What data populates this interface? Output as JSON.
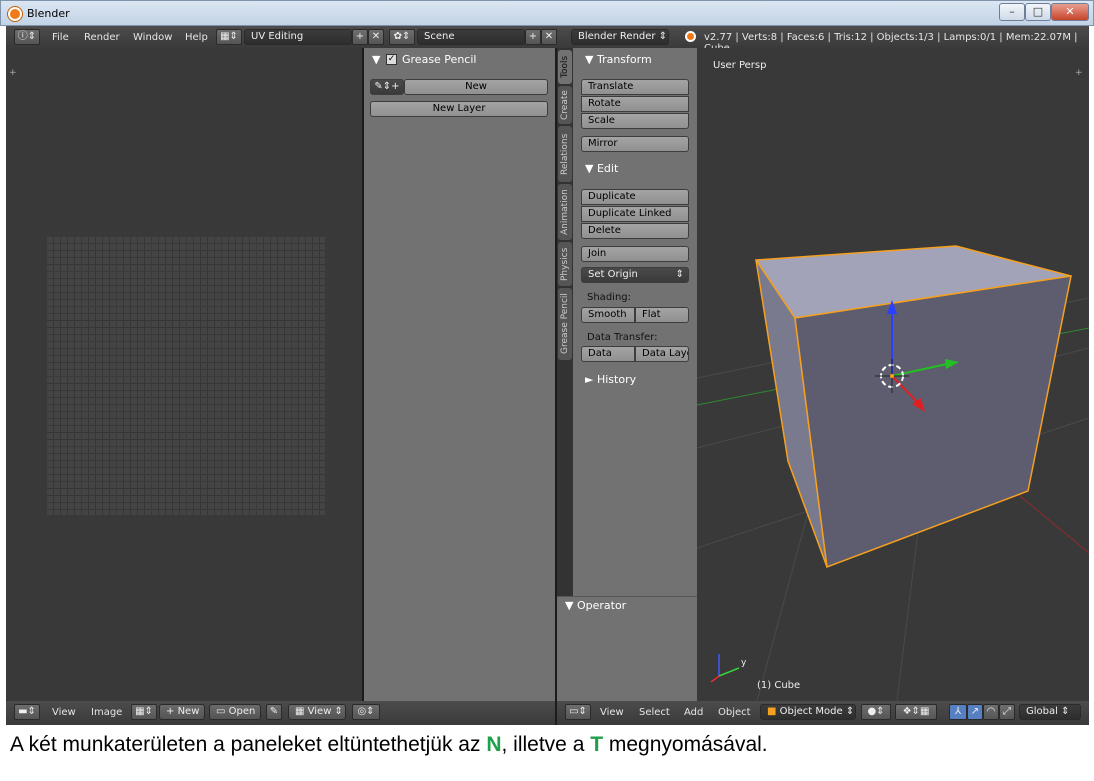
{
  "window": {
    "title": "Blender",
    "min": "–",
    "max": "□",
    "close": "✕"
  },
  "topbar": {
    "menus": [
      "File",
      "Render",
      "Window",
      "Help"
    ],
    "layout": "UV Editing",
    "scene": "Scene",
    "engine": "Blender Render",
    "stats": "v2.77 | Verts:8 | Faces:6 | Tris:12 | Objects:1/3 | Lamps:0/1 | Mem:22.07M | Cube"
  },
  "grease_pencil": {
    "title": "Grease Pencil",
    "new_label": "New",
    "new_layer_label": "New Layer"
  },
  "tabs": [
    "Tools",
    "Create",
    "Relations",
    "Animation",
    "Physics",
    "Grease Pencil"
  ],
  "tools": {
    "transform_title": "Transform",
    "translate": "Translate",
    "rotate": "Rotate",
    "scale": "Scale",
    "mirror": "Mirror",
    "edit_title": "Edit",
    "duplicate": "Duplicate",
    "duplicate_linked": "Duplicate Linked",
    "delete": "Delete",
    "join": "Join",
    "set_origin": "Set Origin",
    "shading_label": "Shading:",
    "smooth": "Smooth",
    "flat": "Flat",
    "data_transfer_label": "Data Transfer:",
    "data": "Data",
    "data_layo": "Data Layo",
    "history_title": "History",
    "operator_title": "Operator"
  },
  "viewport": {
    "persp": "User Persp",
    "object": "(1) Cube",
    "axis_y": "y"
  },
  "uv_footer": {
    "view": "View",
    "image": "Image",
    "new": "New",
    "open": "Open",
    "view2": "View"
  },
  "view3d_footer": {
    "view": "View",
    "select": "Select",
    "add": "Add",
    "object": "Object",
    "mode": "Object Mode",
    "orientation": "Global"
  },
  "caption": {
    "pre": "A két munkaterületen a paneleket eltüntethetjük az ",
    "key1": "N",
    "mid": ", illetve a ",
    "key2": "T",
    "post": " megnyomásával."
  },
  "colors": {
    "accent": "#f07a17",
    "selected_outline": "#f5a020",
    "caption_key": "#20a04a"
  }
}
